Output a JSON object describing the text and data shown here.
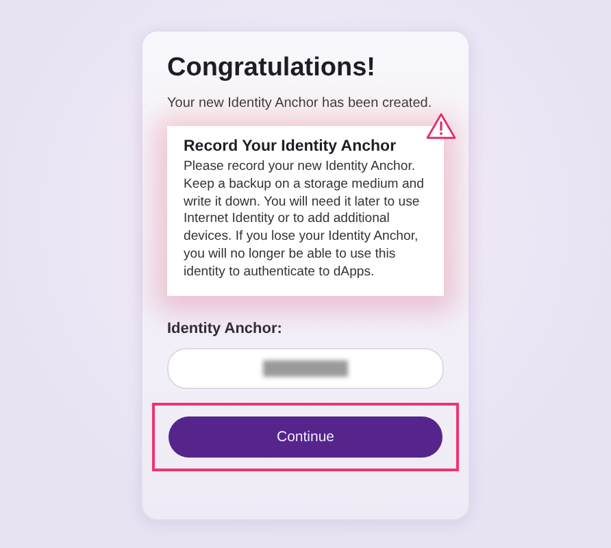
{
  "title": "Congratulations!",
  "subtitle": "Your new Identity Anchor has been created.",
  "warning": {
    "title": "Record Your Identity Anchor",
    "text": "Please record your new Identity Anchor. Keep a backup on a storage medium and write it down. You will need it later to use Internet Identity or to add additional devices. If you lose your Identity Anchor, you will no longer be able to use this identity to authenticate to dApps."
  },
  "anchor_label": "Identity Anchor:",
  "button": {
    "label": "Continue",
    "highlighted": true
  }
}
